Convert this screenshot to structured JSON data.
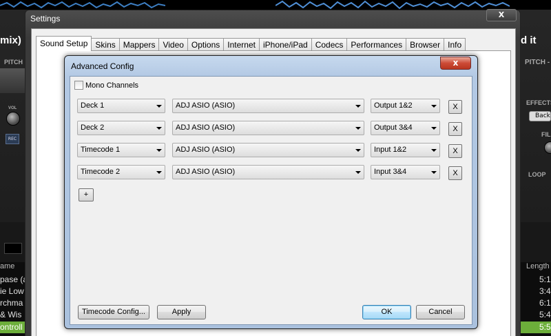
{
  "background_app": {
    "left_fragment": "mix)",
    "right_fragment": "d it",
    "pitch_left": "PITCH",
    "pitch_right": "PITCH -",
    "vol_label": "VOL",
    "rec_label": "REC",
    "effects_label": "EFFECTS",
    "back_label": "Back",
    "filter_label": "FIL",
    "loop_label": "LOOP",
    "col_name": "ame",
    "col_length": "Length",
    "rows_left": [
      "pase (a",
      "ie Low",
      "rchma",
      "& Wis",
      "ontroll"
    ],
    "rows_length": [
      "5:1",
      "3:4",
      "6:1",
      "5:4",
      "5:5"
    ],
    "highlight_color": "#6cae3a"
  },
  "settings": {
    "title": "Settings",
    "close_label": "X",
    "tabs": [
      {
        "label": "Sound Setup",
        "active": true
      },
      {
        "label": "Skins"
      },
      {
        "label": "Mappers"
      },
      {
        "label": "Video"
      },
      {
        "label": "Options"
      },
      {
        "label": "Internet"
      },
      {
        "label": "iPhone/iPad"
      },
      {
        "label": "Codecs"
      },
      {
        "label": "Performances"
      },
      {
        "label": "Browser"
      },
      {
        "label": "Info"
      }
    ]
  },
  "advanced": {
    "title": "Advanced Config",
    "close_label": "x",
    "mono_label": "Mono Channels",
    "mono_checked": false,
    "rows": [
      {
        "channel": "Deck 1",
        "device": "ADJ ASIO (ASIO)",
        "port": "Output 1&2",
        "remove": "X"
      },
      {
        "channel": "Deck 2",
        "device": "ADJ ASIO (ASIO)",
        "port": "Output 3&4",
        "remove": "X"
      },
      {
        "channel": "Timecode 1",
        "device": "ADJ ASIO (ASIO)",
        "port": "Input 1&2",
        "remove": "X"
      },
      {
        "channel": "Timecode 2",
        "device": "ADJ ASIO (ASIO)",
        "port": "Input 3&4",
        "remove": "X"
      }
    ],
    "add_label": "+",
    "timecode_config_label": "Timecode Config...",
    "apply_label": "Apply",
    "ok_label": "OK",
    "cancel_label": "Cancel"
  }
}
